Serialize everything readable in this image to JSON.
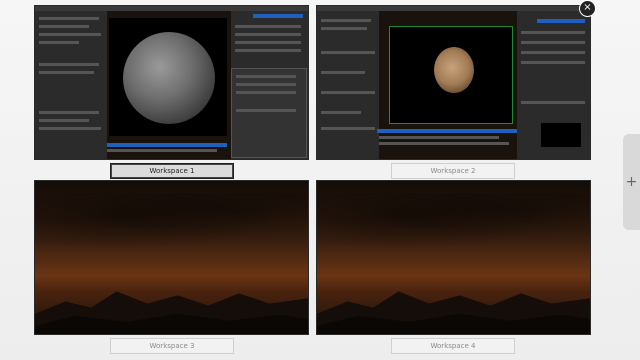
{
  "workspaces": [
    {
      "label": "Workspace 1",
      "active": true
    },
    {
      "label": "Workspace 2",
      "active": false
    },
    {
      "label": "Workspace 3",
      "active": false
    },
    {
      "label": "Workspace 4",
      "active": false
    }
  ],
  "controls": {
    "add_symbol": "+",
    "close_symbol": "×"
  },
  "icons": [
    "close-icon",
    "plus-icon"
  ]
}
